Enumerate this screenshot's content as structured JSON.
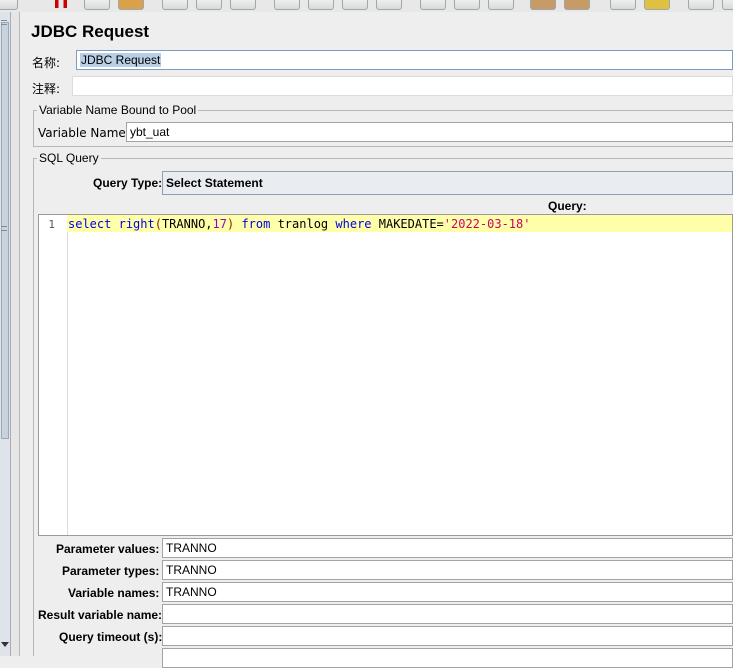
{
  "panel": {
    "title": "JDBC Request",
    "name_label": "名称:",
    "name_value": "JDBC Request",
    "comments_label": "注释:",
    "comments_value": ""
  },
  "pool_section": {
    "legend": "Variable Name Bound to Pool",
    "variable_name_label": "Variable Name:",
    "variable_name_value": "ybt_uat"
  },
  "sql_section": {
    "legend": "SQL Query",
    "query_type_label": "Query Type:",
    "query_type_value": "Select Statement",
    "query_label": "Query:",
    "line_number": "1",
    "query_tokens": [
      {
        "t": "select",
        "k": "kw"
      },
      {
        "t": " ",
        "k": "pl"
      },
      {
        "t": "right",
        "k": "kw"
      },
      {
        "t": "(",
        "k": "par"
      },
      {
        "t": "TRANNO,",
        "k": "pl"
      },
      {
        "t": "17",
        "k": "num"
      },
      {
        "t": ")",
        "k": "par"
      },
      {
        "t": " ",
        "k": "pl"
      },
      {
        "t": "from",
        "k": "kw"
      },
      {
        "t": " tranlog ",
        "k": "pl"
      },
      {
        "t": "where",
        "k": "kw"
      },
      {
        "t": " MAKEDATE=",
        "k": "pl"
      },
      {
        "t": "'2022-03-18'",
        "k": "str"
      }
    ]
  },
  "params": {
    "parameter_values_label": "Parameter values:",
    "parameter_values_value": "TRANNO",
    "parameter_types_label": "Parameter types:",
    "parameter_types_value": "TRANNO",
    "variable_names_label": "Variable names:",
    "variable_names_value": "TRANNO",
    "result_variable_label": "Result variable name:",
    "result_variable_value": "",
    "query_timeout_label": "Query timeout (s):",
    "query_timeout_value": ""
  }
}
